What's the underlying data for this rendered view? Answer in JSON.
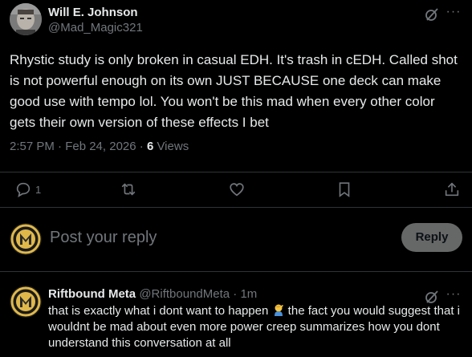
{
  "tweet": {
    "author": {
      "display_name": "Will E. Johnson",
      "handle": "@Mad_Magic321"
    },
    "text": "Rhystic study is only broken in casual EDH. It's trash in cEDH. Called shot is not powerful enough on its own JUST BECAUSE one deck can make good use with tempo lol. You won't be this mad when every other color gets their own version of these effects I bet",
    "timestamp": "2:57 PM · Feb 24, 2026 · ",
    "views_count": "6",
    "views_label": " Views",
    "more_label": "···"
  },
  "actions": {
    "reply_count": "1",
    "icons": [
      "reply-icon",
      "retweet-icon",
      "like-icon",
      "bookmark-icon",
      "share-icon"
    ]
  },
  "composer": {
    "placeholder": "Post your reply",
    "button_label": "Reply"
  },
  "reply": {
    "author_name": "Riftbound Meta",
    "meta": " @RiftboundMeta · 1m",
    "text_before_emoji": "that is exactly what i dont want to happen ",
    "text_after_emoji": " the fact you would suggest that i wouldnt be mad about even more power creep summarizes how you dont understand this conversation at all",
    "more_label": "···"
  },
  "colors": {
    "background": "#000000",
    "text_primary": "#e7e9ea",
    "text_secondary": "#71767b",
    "divider": "#2f3336",
    "reply_button_bg": "#787a7a",
    "meta_avatar_gold": "#e0b84a"
  }
}
